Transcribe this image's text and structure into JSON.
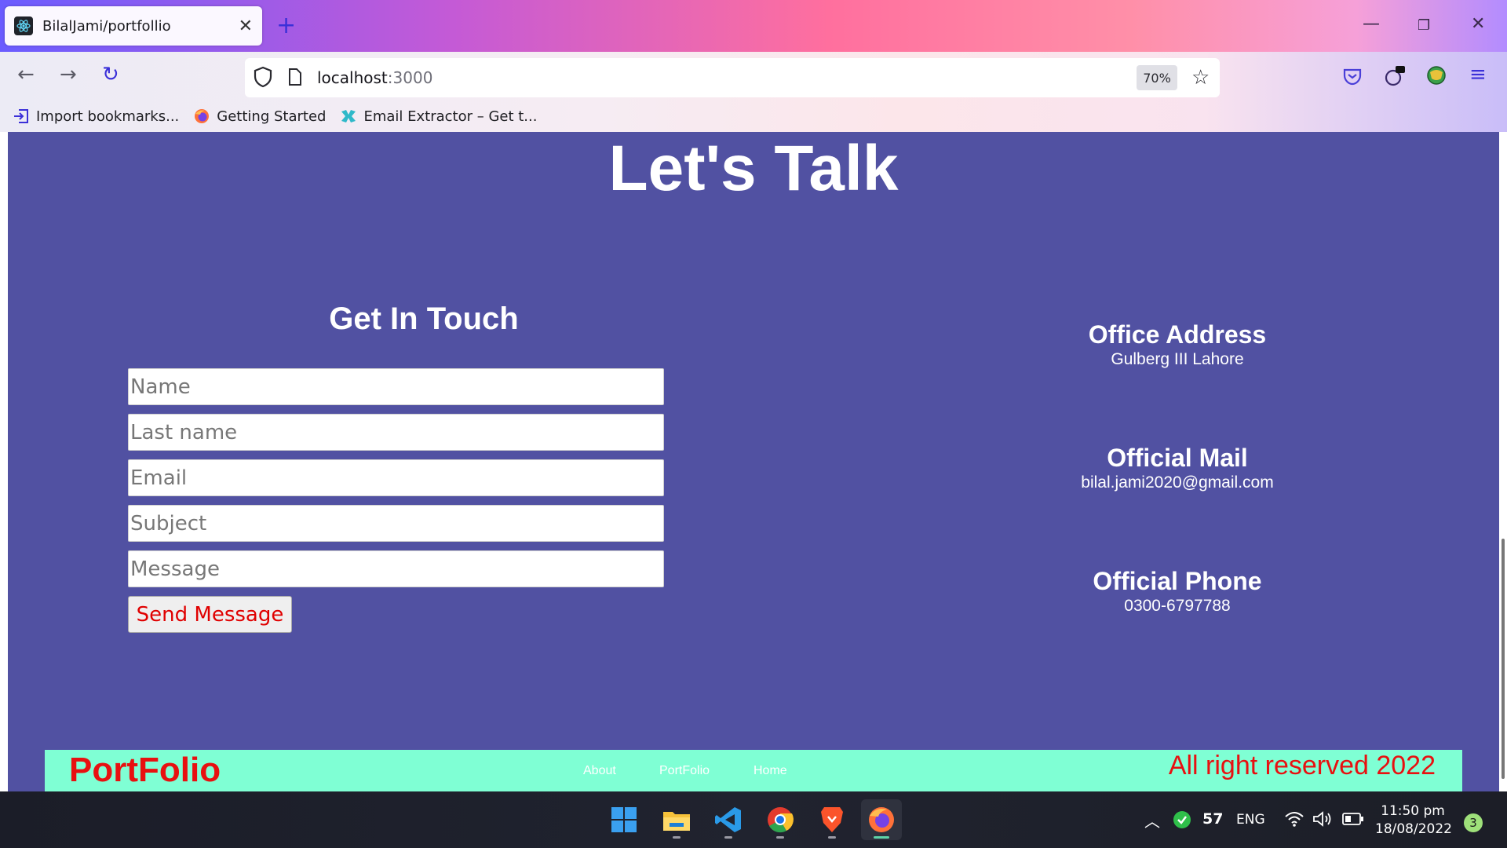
{
  "browser": {
    "tab_title": "BilalJami/portfollio",
    "url_host": "localhost",
    "url_port": ":3000",
    "zoom": "70%",
    "bookmarks": [
      {
        "label": "Import bookmarks...",
        "icon": "import-icon"
      },
      {
        "label": "Getting Started",
        "icon": "firefox-icon"
      },
      {
        "label": "Email Extractor – Get t...",
        "icon": "extractor-icon"
      }
    ]
  },
  "page": {
    "heading": "Let's Talk",
    "form": {
      "title": "Get In Touch",
      "fields": [
        {
          "placeholder": "Name",
          "value": ""
        },
        {
          "placeholder": "Last name",
          "value": ""
        },
        {
          "placeholder": "Email",
          "value": ""
        },
        {
          "placeholder": "Subject",
          "value": ""
        },
        {
          "placeholder": "Message",
          "value": ""
        }
      ],
      "submit_label": "Send Message"
    },
    "info": [
      {
        "heading": "Office Address",
        "value": "Gulberg III Lahore"
      },
      {
        "heading": "Official Mail",
        "value": "bilal.jami2020@gmail.com"
      },
      {
        "heading": "Official Phone",
        "value": "0300-6797788"
      }
    ],
    "footer": {
      "brand": "PortFolio",
      "links": [
        "About",
        "PortFolio",
        "Home"
      ],
      "copyright": "All right reserved 2022"
    }
  },
  "taskbar": {
    "apps": [
      "windows-start-icon",
      "file-explorer-icon",
      "vscode-icon",
      "chrome-icon",
      "brave-icon",
      "firefox-icon"
    ],
    "tray": {
      "temperature": "57",
      "language": "ENG",
      "time": "11:50 pm",
      "date": "18/08/2022",
      "notifications": "3"
    }
  },
  "colors": {
    "page_bg": "#5151a2",
    "footer_bg": "#7fffd4",
    "accent_red": "#e81010"
  }
}
